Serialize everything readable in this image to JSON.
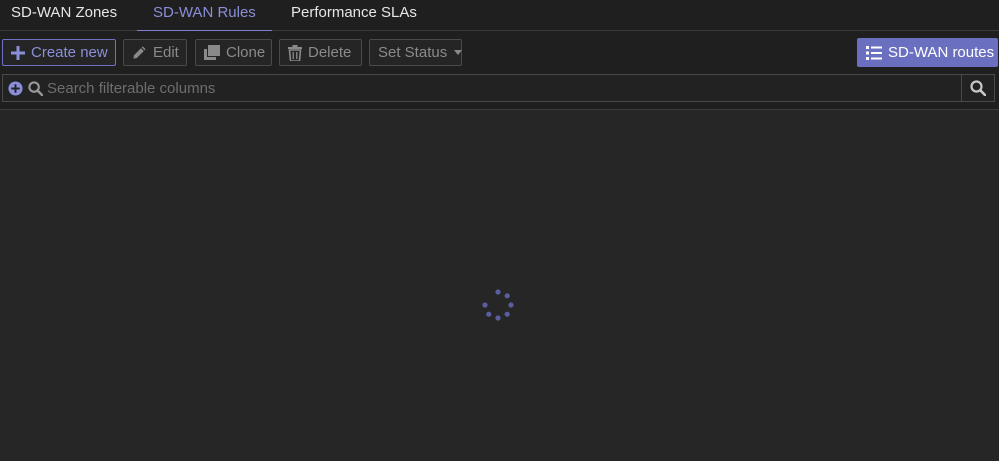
{
  "tabs": [
    {
      "label": "SD-WAN Zones",
      "active": false
    },
    {
      "label": "SD-WAN Rules",
      "active": true
    },
    {
      "label": "Performance SLAs",
      "active": false
    }
  ],
  "toolbar": {
    "create_label": "Create new",
    "edit_label": "Edit",
    "clone_label": "Clone",
    "delete_label": "Delete",
    "set_status_label": "Set Status",
    "routes_label": "SD-WAN routes"
  },
  "search": {
    "placeholder": "Search filterable columns",
    "value": ""
  },
  "colors": {
    "accent": "#7b80d0",
    "accent_button": "#6b6fc0",
    "background": "#262626",
    "panel": "#1f1f1f"
  },
  "icons": {
    "create": "plus-icon",
    "edit": "pencil-icon",
    "clone": "clone-icon",
    "delete": "trash-icon",
    "set_status": "caret-down-icon",
    "routes": "list-icon",
    "add_filter": "plus-circle-icon",
    "search": "search-icon",
    "loading": "loading-spinner-icon"
  }
}
